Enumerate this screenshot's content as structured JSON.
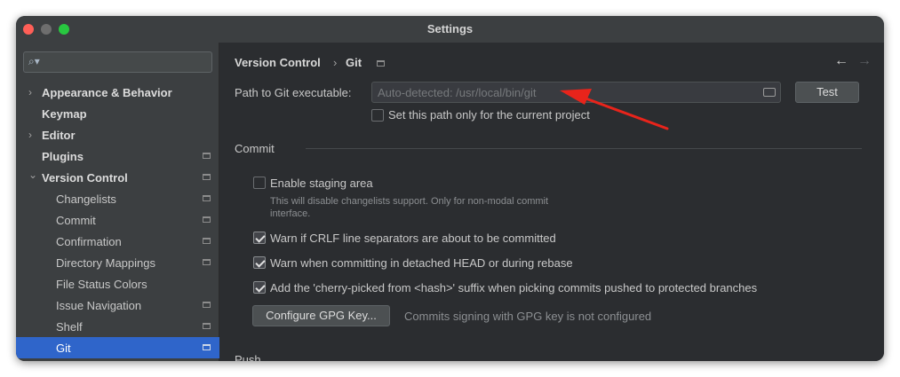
{
  "window": {
    "title": "Settings"
  },
  "sidebar": {
    "search_placeholder": "",
    "items": [
      {
        "label": "Appearance & Behavior",
        "chevron": "›",
        "bold": true
      },
      {
        "label": "Keymap",
        "bold": true
      },
      {
        "label": "Editor",
        "chevron": "›",
        "bold": true
      },
      {
        "label": "Plugins",
        "bold": true
      },
      {
        "label": "Version Control",
        "chevron": "⌄",
        "bold": true
      },
      {
        "label": "Changelists"
      },
      {
        "label": "Commit"
      },
      {
        "label": "Confirmation"
      },
      {
        "label": "Directory Mappings"
      },
      {
        "label": "File Status Colors"
      },
      {
        "label": "Issue Navigation"
      },
      {
        "label": "Shelf"
      },
      {
        "label": "Git",
        "selected": true
      }
    ]
  },
  "breadcrumb": {
    "parent": "Version Control",
    "separator": "›",
    "current": "Git"
  },
  "nav": {
    "back": "←",
    "forward": "→"
  },
  "git_path": {
    "label": "Path to Git executable:",
    "value": "Auto-detected: /usr/local/bin/git",
    "test_button": "Test",
    "current_project_checkbox": "Set this path only for the current project"
  },
  "commit": {
    "section_title": "Commit",
    "enable_staging": "Enable staging area",
    "staging_hint_line1": "This will disable changelists support. Only for non-modal commit",
    "staging_hint_line2": "interface.",
    "warn_crlf": "Warn if CRLF line separators are about to be committed",
    "warn_detached": "Warn when committing in detached HEAD or during rebase",
    "cherry_pick_suffix": "Add the 'cherry-picked from <hash>' suffix when picking commits pushed to protected branches",
    "gpg_button": "Configure GPG Key...",
    "gpg_status": "Commits signing with GPG key is not configured"
  },
  "next_section_partial": "Push",
  "colors": {
    "accent": "#2f65ca",
    "annotation_arrow": "#e8241b"
  }
}
